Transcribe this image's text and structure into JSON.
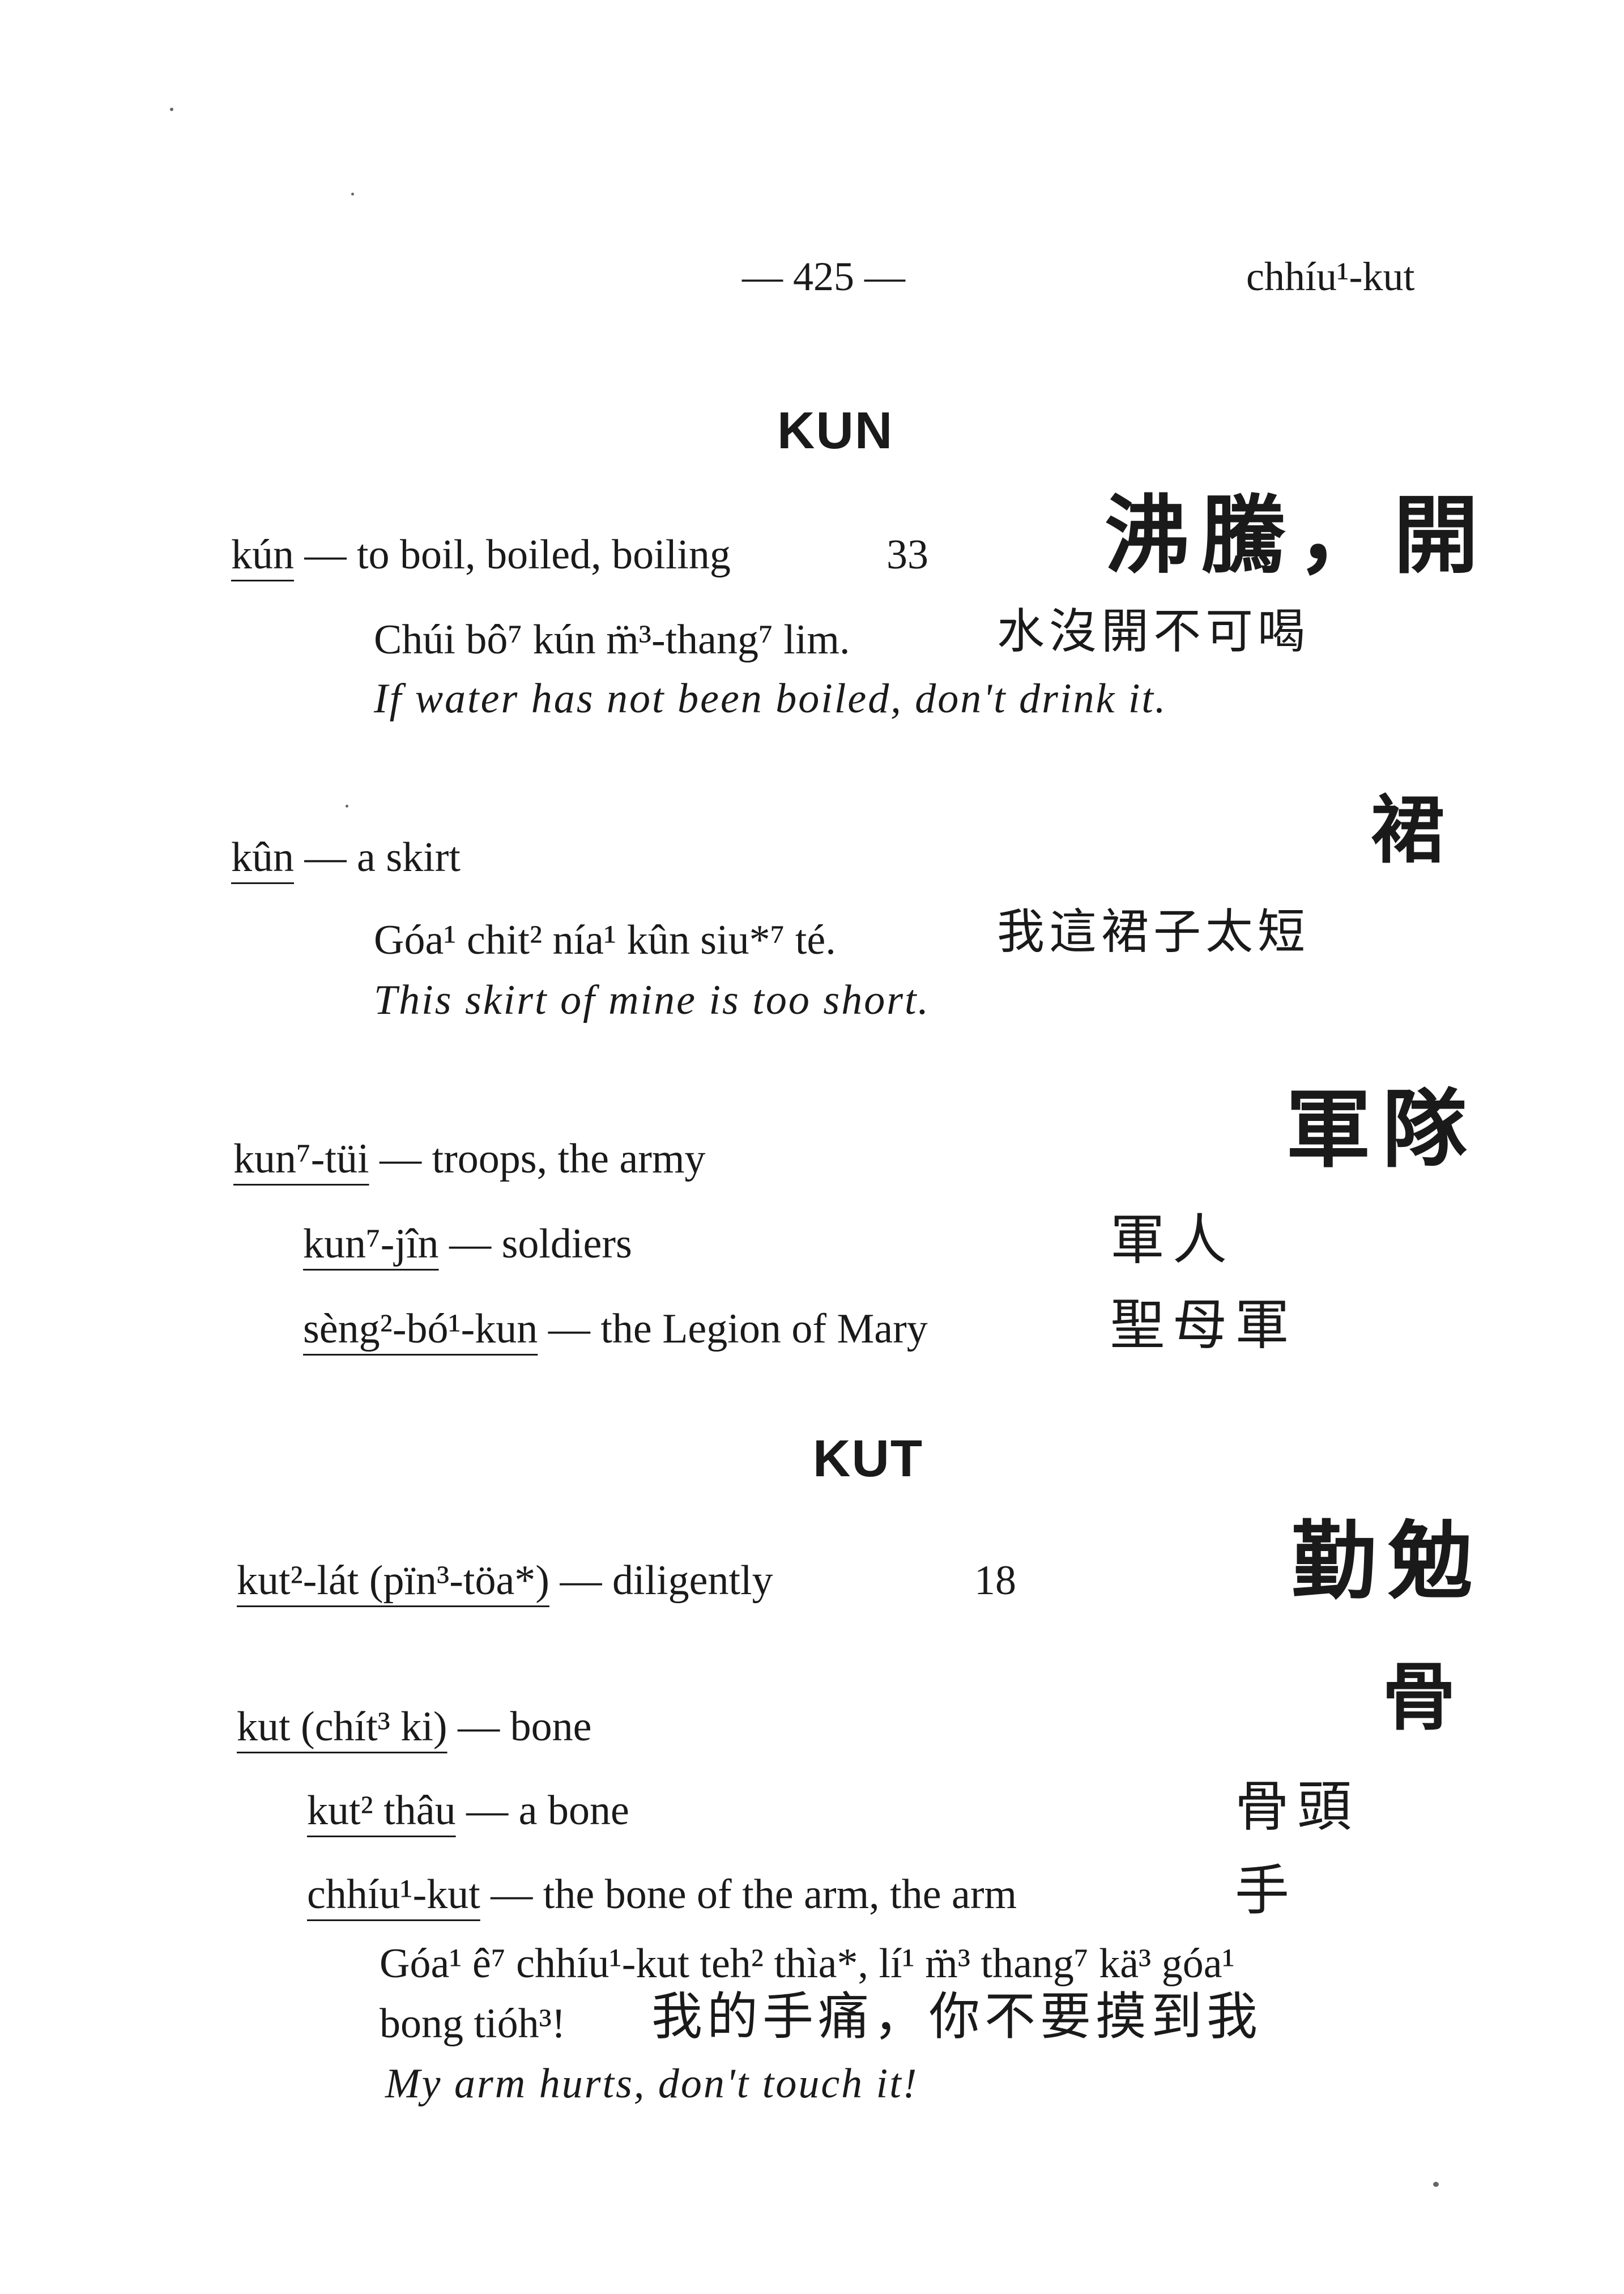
{
  "header": {
    "page_number": "— 425 —",
    "running_head": "chhíu¹-kut"
  },
  "kun_section": {
    "heading": "KUN",
    "e1": {
      "term": "kún",
      "gloss": " — to boil, boiled, boiling",
      "num": "33",
      "hanzi": "沸騰，開",
      "ex_rom": "Chúi bô⁷ kún m̈³-thang⁷ lim.",
      "ex_hanzi": "水沒開不可喝",
      "ex_en": "If water has not been boiled, don't drink it."
    },
    "e2": {
      "term": "kûn",
      "gloss": " — a skirt",
      "hanzi": "裙",
      "ex_rom": "Góa¹ chit² nía¹ kûn siu*⁷ té.",
      "ex_hanzi": "我這裙子太短",
      "ex_en": "This skirt of mine is too short."
    },
    "e3": {
      "term": "kun⁷-tüi",
      "gloss": " — troops, the army",
      "hanzi": "軍隊",
      "sub1_term": "kun⁷-jîn",
      "sub1_gloss": " — soldiers",
      "sub1_hanzi": "軍人",
      "sub2_term": "sèng²-bó¹-kun",
      "sub2_gloss": " — the Legion of Mary",
      "sub2_hanzi": "聖母軍"
    }
  },
  "kut_section": {
    "heading": "KUT",
    "e1": {
      "term": "kut²-lát (pïn³-töa*)",
      "gloss": " — diligently",
      "num": "18",
      "hanzi": "勤勉"
    },
    "e2": {
      "term": "kut (chít³ ki)",
      "gloss": " — bone",
      "hanzi": "骨",
      "sub1_term": "kut² thâu",
      "sub1_gloss": " — a bone",
      "sub1_hanzi": "骨頭",
      "sub2_term": "chhíu¹-kut",
      "sub2_gloss": " — the bone of the arm, the arm",
      "sub2_hanzi": "手",
      "ex_rom1": "Góa¹ ê⁷ chhíu¹-kut teh² thìa*, lí¹ m̈³ thang⁷ kä³ góa¹",
      "ex_rom2": "bong tióh³!",
      "ex_hanzi": "我的手痛，你不要摸到我",
      "ex_en": "My arm hurts, don't touch it!"
    }
  }
}
